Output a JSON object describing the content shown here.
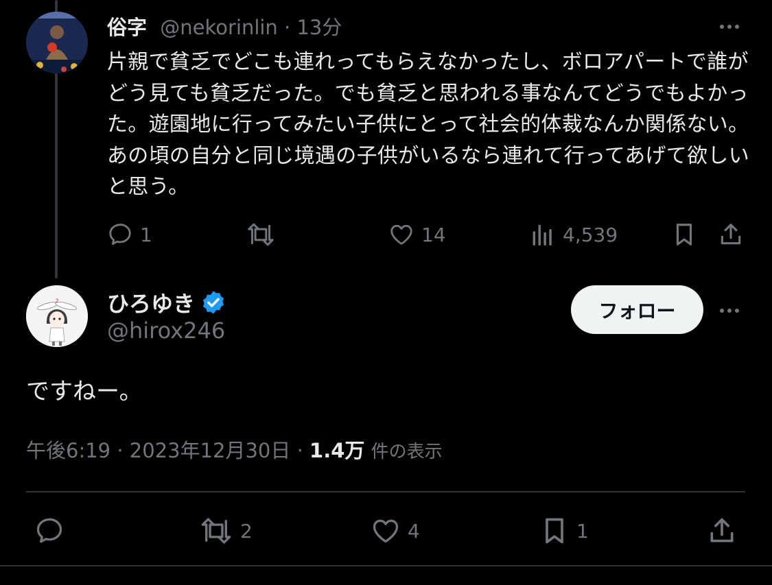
{
  "reply_tweet": {
    "display_name": "俗字",
    "handle": "@nekorinlin",
    "separator": "·",
    "time_ago": "13分",
    "text": "片親で貧乏でどこも連れってもらえなかったし、ボロアパートで誰がどう見ても貧乏だった。でも貧乏と思われる事なんてどうでもよかった。遊園地に行ってみたい子供にとって社会的体裁なんか関係ない。あの頃の自分と同じ境遇の子供がいるなら連れて行ってあげて欲しいと思う。",
    "more_label": "•••",
    "actions": {
      "reply_count": "1",
      "retweet_count": "",
      "like_count": "14",
      "view_count": "4,539"
    }
  },
  "main_tweet": {
    "display_name": "ひろゆき",
    "handle": "@hirox246",
    "follow_label": "フォロー",
    "more_label": "•••",
    "text": "ですねー。",
    "meta": {
      "time": "午後6:19",
      "sep1": "·",
      "date": "2023年12月30日",
      "sep2": "·",
      "views": "1.4万",
      "views_suffix": "件の表示"
    },
    "actions": {
      "reply_count": "",
      "retweet_count": "2",
      "like_count": "4",
      "bookmark_count": "1"
    }
  },
  "colors": {
    "background": "#000000",
    "text": "#e7e9ea",
    "muted": "#71767b",
    "verified": "#1d9bf0",
    "follow_bg": "#eff3f4"
  }
}
